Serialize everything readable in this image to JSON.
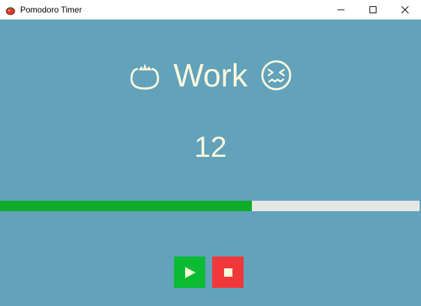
{
  "window": {
    "title": "Pomodoro Timer",
    "icons": {
      "app": "tomato-icon",
      "minimize": "minimize-icon",
      "maximize": "maximize-icon",
      "close": "close-icon"
    }
  },
  "heading": {
    "label": "Work",
    "left_icon": "tomato-outline-icon",
    "right_icon": "stressed-face-icon"
  },
  "timer": {
    "value": "12"
  },
  "progress": {
    "fraction": 0.6
  },
  "controls": {
    "play_icon": "play-icon",
    "stop_icon": "stop-icon"
  },
  "colors": {
    "background": "#62a2bb",
    "text": "#fbf8dd",
    "progress_fill": "#0eac2a",
    "progress_track": "#e6e6e6",
    "play": "#0bbb32",
    "stop": "#f0383a"
  }
}
